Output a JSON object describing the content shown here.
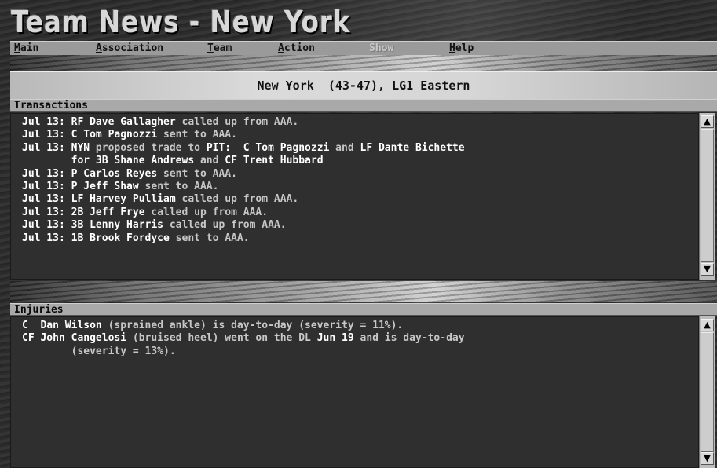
{
  "window": {
    "title": "Team News - New York"
  },
  "menu": [
    {
      "label": "Main",
      "accel": "M",
      "rest": "ain",
      "enabled": true
    },
    {
      "label": "Association",
      "accel": "A",
      "rest": "ssociation",
      "enabled": true
    },
    {
      "label": "Team",
      "accel": "T",
      "rest": "eam",
      "enabled": true
    },
    {
      "label": "Action",
      "accel": "A",
      "rest": "ction",
      "enabled": true
    },
    {
      "label": "Show",
      "accel": "",
      "rest": "Show",
      "enabled": false
    },
    {
      "label": "Help",
      "accel": "H",
      "rest": "elp",
      "enabled": true
    }
  ],
  "header": {
    "team_line": "New York  (43-47), LG1 Eastern"
  },
  "transactions": {
    "label": "Transactions",
    "lines": [
      [
        {
          "t": "Jul 13: RF Dave Gallagher",
          "b": true
        },
        {
          "t": " called up from AAA.",
          "b": false
        }
      ],
      [
        {
          "t": "Jul 13: C Tom Pagnozzi",
          "b": true
        },
        {
          "t": " sent to AAA.",
          "b": false
        }
      ],
      [
        {
          "t": "Jul 13: NYN",
          "b": true
        },
        {
          "t": " proposed trade to ",
          "b": false
        },
        {
          "t": "PIT:  C Tom Pagnozzi",
          "b": true
        },
        {
          "t": " and ",
          "b": false
        },
        {
          "t": "LF Dante Bichette",
          "b": true
        }
      ],
      [
        {
          "t": "        for 3B Shane Andrews",
          "b": true
        },
        {
          "t": " and ",
          "b": false
        },
        {
          "t": "CF Trent Hubbard",
          "b": true
        }
      ],
      [
        {
          "t": "Jul 13: P Carlos Reyes",
          "b": true
        },
        {
          "t": " sent to AAA.",
          "b": false
        }
      ],
      [
        {
          "t": "Jul 13: P Jeff Shaw",
          "b": true
        },
        {
          "t": " sent to AAA.",
          "b": false
        }
      ],
      [
        {
          "t": "Jul 13: LF Harvey Pulliam",
          "b": true
        },
        {
          "t": " called up from AAA.",
          "b": false
        }
      ],
      [
        {
          "t": "Jul 13: 2B Jeff Frye",
          "b": true
        },
        {
          "t": " called up from AAA.",
          "b": false
        }
      ],
      [
        {
          "t": "Jul 13: 3B Lenny Harris",
          "b": true
        },
        {
          "t": " called up from AAA.",
          "b": false
        }
      ],
      [
        {
          "t": "Jul 13: 1B Brook Fordyce",
          "b": true
        },
        {
          "t": " sent to AAA.",
          "b": false
        }
      ]
    ]
  },
  "injuries": {
    "label": "Injuries",
    "lines": [
      [
        {
          "t": "C  Dan Wilson",
          "b": true
        },
        {
          "t": " (sprained ankle) is day-to-day (severity = 11%).",
          "b": false
        }
      ],
      [
        {
          "t": "CF John Cangelosi",
          "b": true
        },
        {
          "t": " (bruised heel) went on the DL ",
          "b": false
        },
        {
          "t": "Jun 19",
          "b": true
        },
        {
          "t": " and is day-to-day",
          "b": false
        }
      ],
      [
        {
          "t": "        (severity = 13%).",
          "b": false
        }
      ]
    ]
  },
  "scroll_icons": {
    "up": "▲",
    "down": "▼"
  }
}
